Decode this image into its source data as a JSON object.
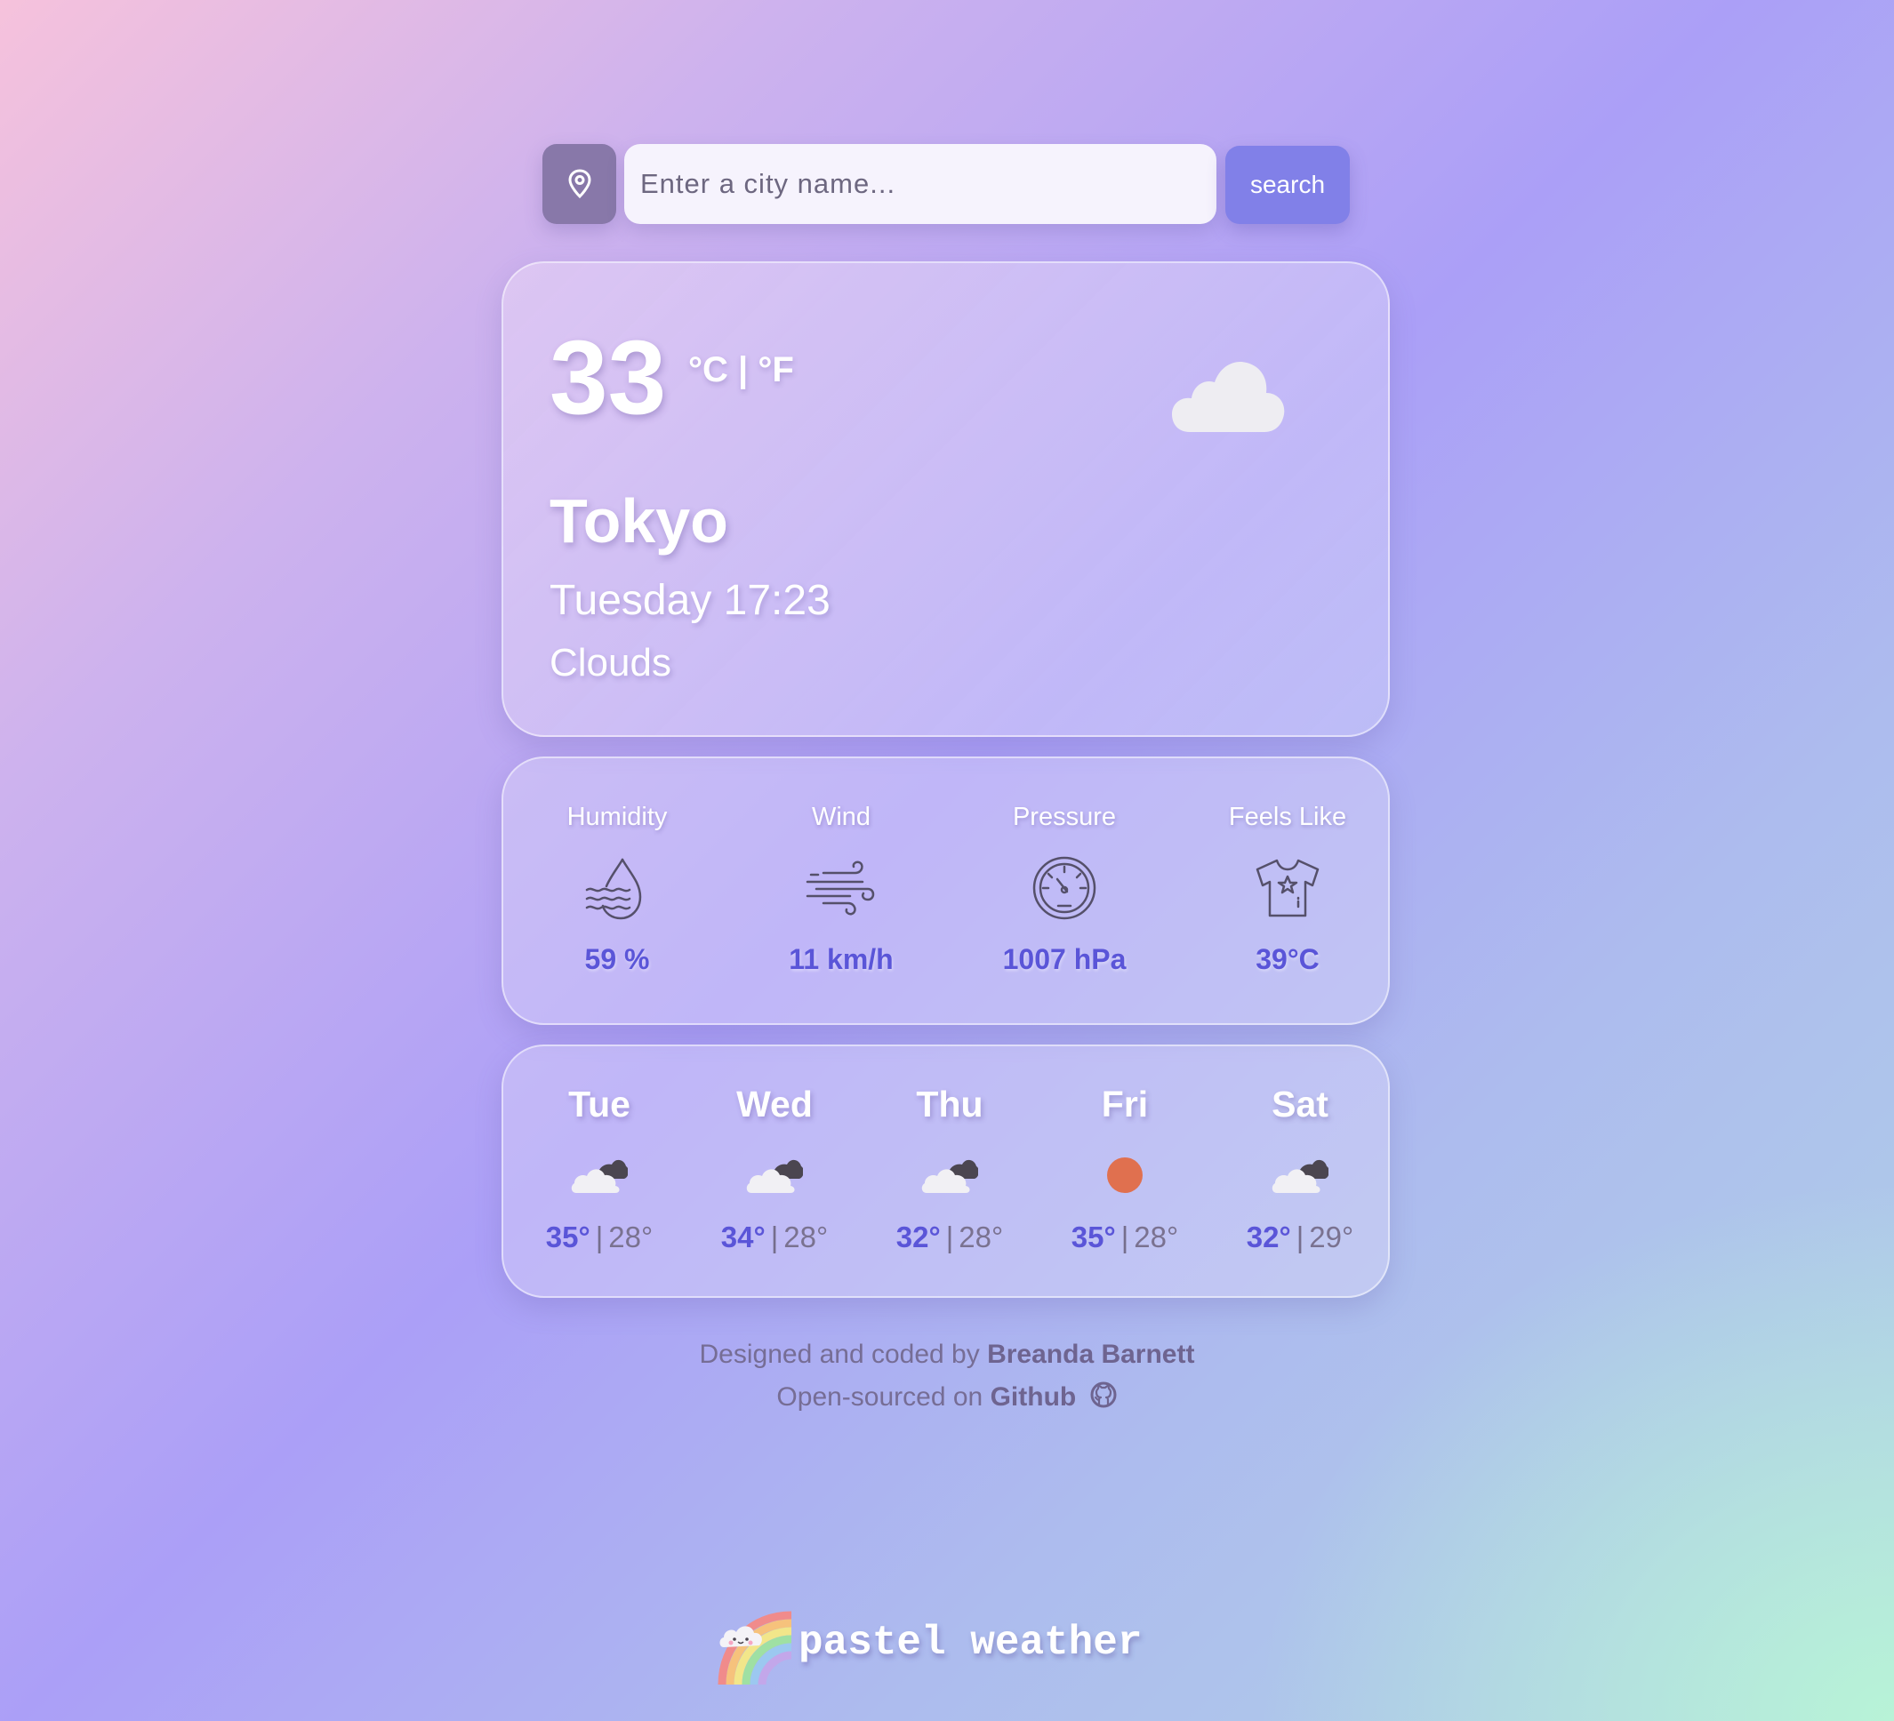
{
  "search": {
    "placeholder": "Enter a city name...",
    "button_label": "search",
    "location_icon": "map-pin-icon"
  },
  "current": {
    "temperature": "33",
    "unit_c": "°C",
    "unit_separator": "|",
    "unit_f": "°F",
    "city": "Tokyo",
    "datetime": "Tuesday 17:23",
    "condition": "Clouds",
    "icon": "cloud-icon"
  },
  "details": [
    {
      "label": "Humidity",
      "value": "59 %",
      "icon": "humidity-drop-icon"
    },
    {
      "label": "Wind",
      "value": "11 km/h",
      "icon": "wind-icon"
    },
    {
      "label": "Pressure",
      "value": "1007 hPa",
      "icon": "gauge-icon"
    },
    {
      "label": "Feels Like",
      "value": "39°C",
      "icon": "tshirt-icon"
    }
  ],
  "forecast": [
    {
      "day": "Tue",
      "max": "35°",
      "min": "28°",
      "icon": "broken-clouds-icon"
    },
    {
      "day": "Wed",
      "max": "34°",
      "min": "28°",
      "icon": "broken-clouds-icon"
    },
    {
      "day": "Thu",
      "max": "32°",
      "min": "28°",
      "icon": "broken-clouds-icon"
    },
    {
      "day": "Fri",
      "max": "35°",
      "min": "28°",
      "icon": "sun-icon"
    },
    {
      "day": "Sat",
      "max": "32°",
      "min": "29°",
      "icon": "broken-clouds-icon"
    }
  ],
  "temp_separator": "|",
  "footer": {
    "designed_text": "Designed and coded by",
    "author": "Breanda Barnett",
    "opensourced_text": "Open-sourced on",
    "github_label": "Github"
  },
  "brand": {
    "name": "pastel weather",
    "logo_icon": "rainbow-cloud-icon"
  },
  "colors": {
    "accent": "#8180e8",
    "value_text": "#5a55d8",
    "location_button": "#8878a9",
    "sun": "#e0704f"
  }
}
